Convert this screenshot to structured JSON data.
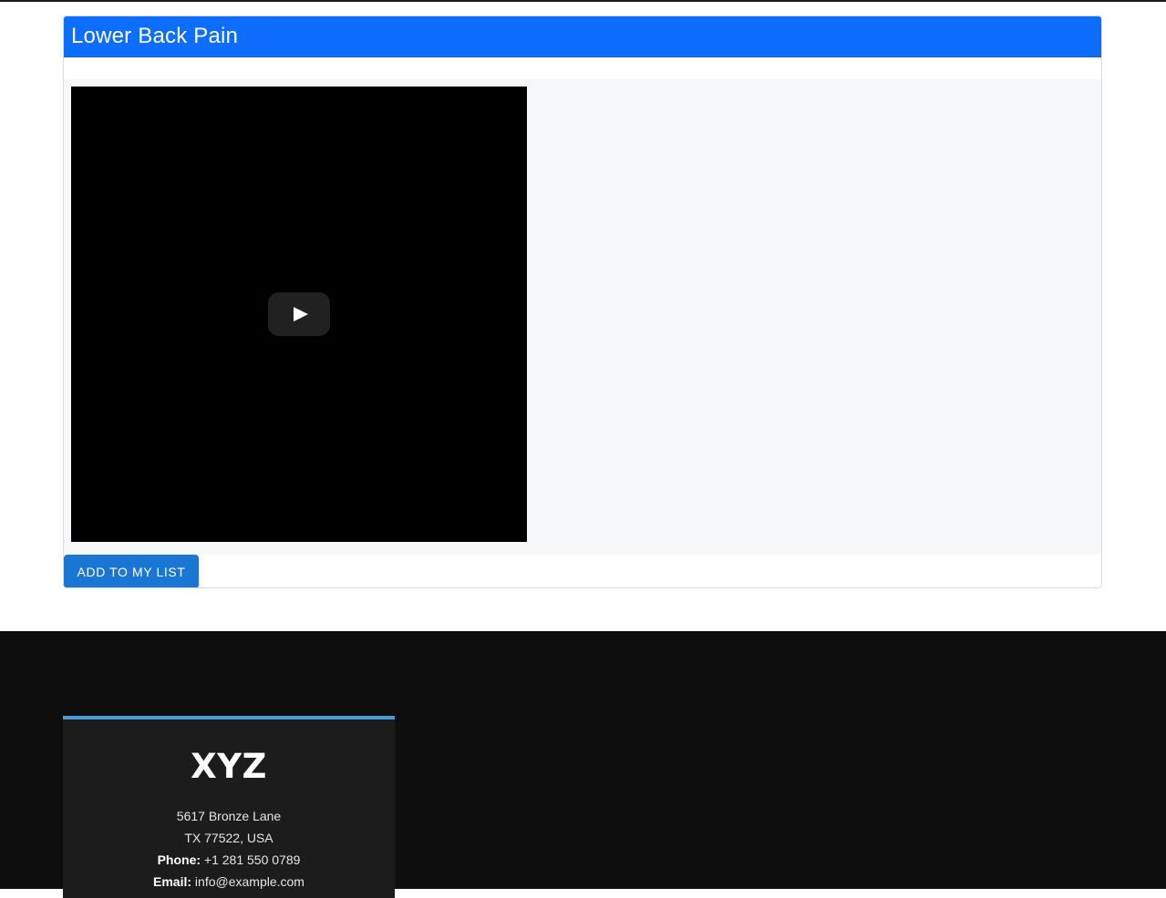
{
  "page": {
    "title": "Lower Back Pain"
  },
  "video": {
    "play_label": "Play"
  },
  "actions": {
    "add_to_list_label": "ADD TO MY LIST"
  },
  "footer": {
    "brand": "XYZ",
    "address_line1": "5617 Bronze Lane",
    "address_line2": "TX 77522, USA",
    "phone_label": "Phone:",
    "phone_value": "+1 281 550 0789",
    "email_label": "Email:",
    "email_value": "info@example.com"
  },
  "colors": {
    "header_blue": "#0d6efd",
    "button_blue": "#1976d2",
    "footer_accent": "#4a9ad6",
    "footer_bg": "#0e0e0e"
  }
}
